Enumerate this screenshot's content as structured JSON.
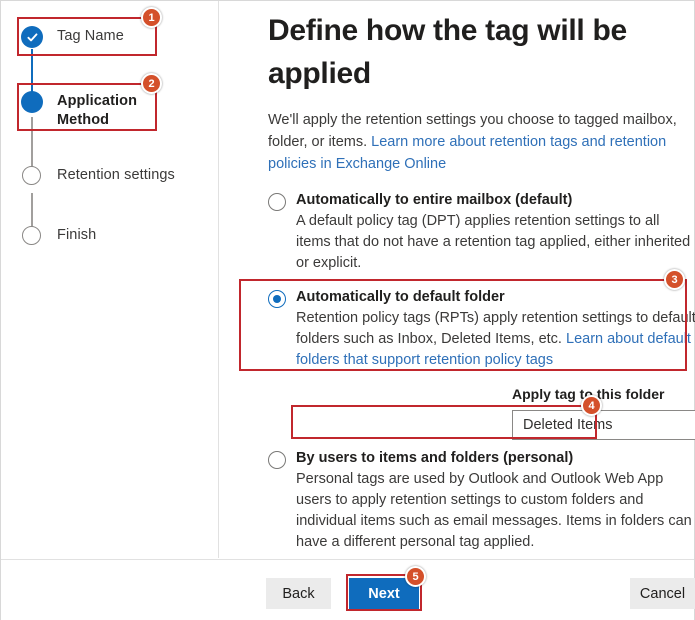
{
  "sidebar": {
    "steps": [
      {
        "label": "Tag Name",
        "state": "completed",
        "marker": "check-circle-icon"
      },
      {
        "label": "Application Method",
        "state": "current",
        "marker": "filled-circle-icon"
      },
      {
        "label": "Retention settings",
        "state": "pending",
        "marker": "empty-circle-icon"
      },
      {
        "label": "Finish",
        "state": "pending",
        "marker": "empty-circle-icon"
      }
    ]
  },
  "main": {
    "title": "Define how the tag will be applied",
    "intro": {
      "text_before": "We'll apply the retention settings you choose to tagged mailbox, folder, or items. ",
      "link": "Learn more about retention tags and retention policies in Exchange Online"
    },
    "options": [
      {
        "title": "Automatically to entire mailbox (default)",
        "description": "A default policy tag (DPT) applies retention settings to all items that do not have a retention tag applied, either inherited or explicit.",
        "selected": false
      },
      {
        "title": "Automatically to default folder",
        "description_before": "Retention policy tags (RPTs) apply retention settings to default folders such as Inbox, Deleted Items, etc. ",
        "description_link": "Learn about default folders that support retention policy tags",
        "selected": true
      },
      {
        "title": "By users to items and folders (personal)",
        "description": "Personal tags are used by Outlook and Outlook Web App users to apply retention settings to custom folders and individual items such as email messages. Items in folders can have a different personal tag applied.",
        "selected": false
      }
    ],
    "folder_field": {
      "label": "Apply tag to this folder",
      "value": "Deleted Items",
      "chevron": "chevron-down-icon"
    }
  },
  "footer": {
    "back_label": "Back",
    "next_label": "Next",
    "cancel_label": "Cancel"
  },
  "annotations": {
    "badges": [
      {
        "number": "1"
      },
      {
        "number": "2"
      },
      {
        "number": "3"
      },
      {
        "number": "4"
      },
      {
        "number": "5"
      }
    ]
  },
  "colors": {
    "accent_blue": "#0f6cbd",
    "link_blue": "#2f70b8",
    "annotation_red": "#c1272d",
    "badge_orange": "#d4502a",
    "button_grey": "#ebebeb"
  }
}
